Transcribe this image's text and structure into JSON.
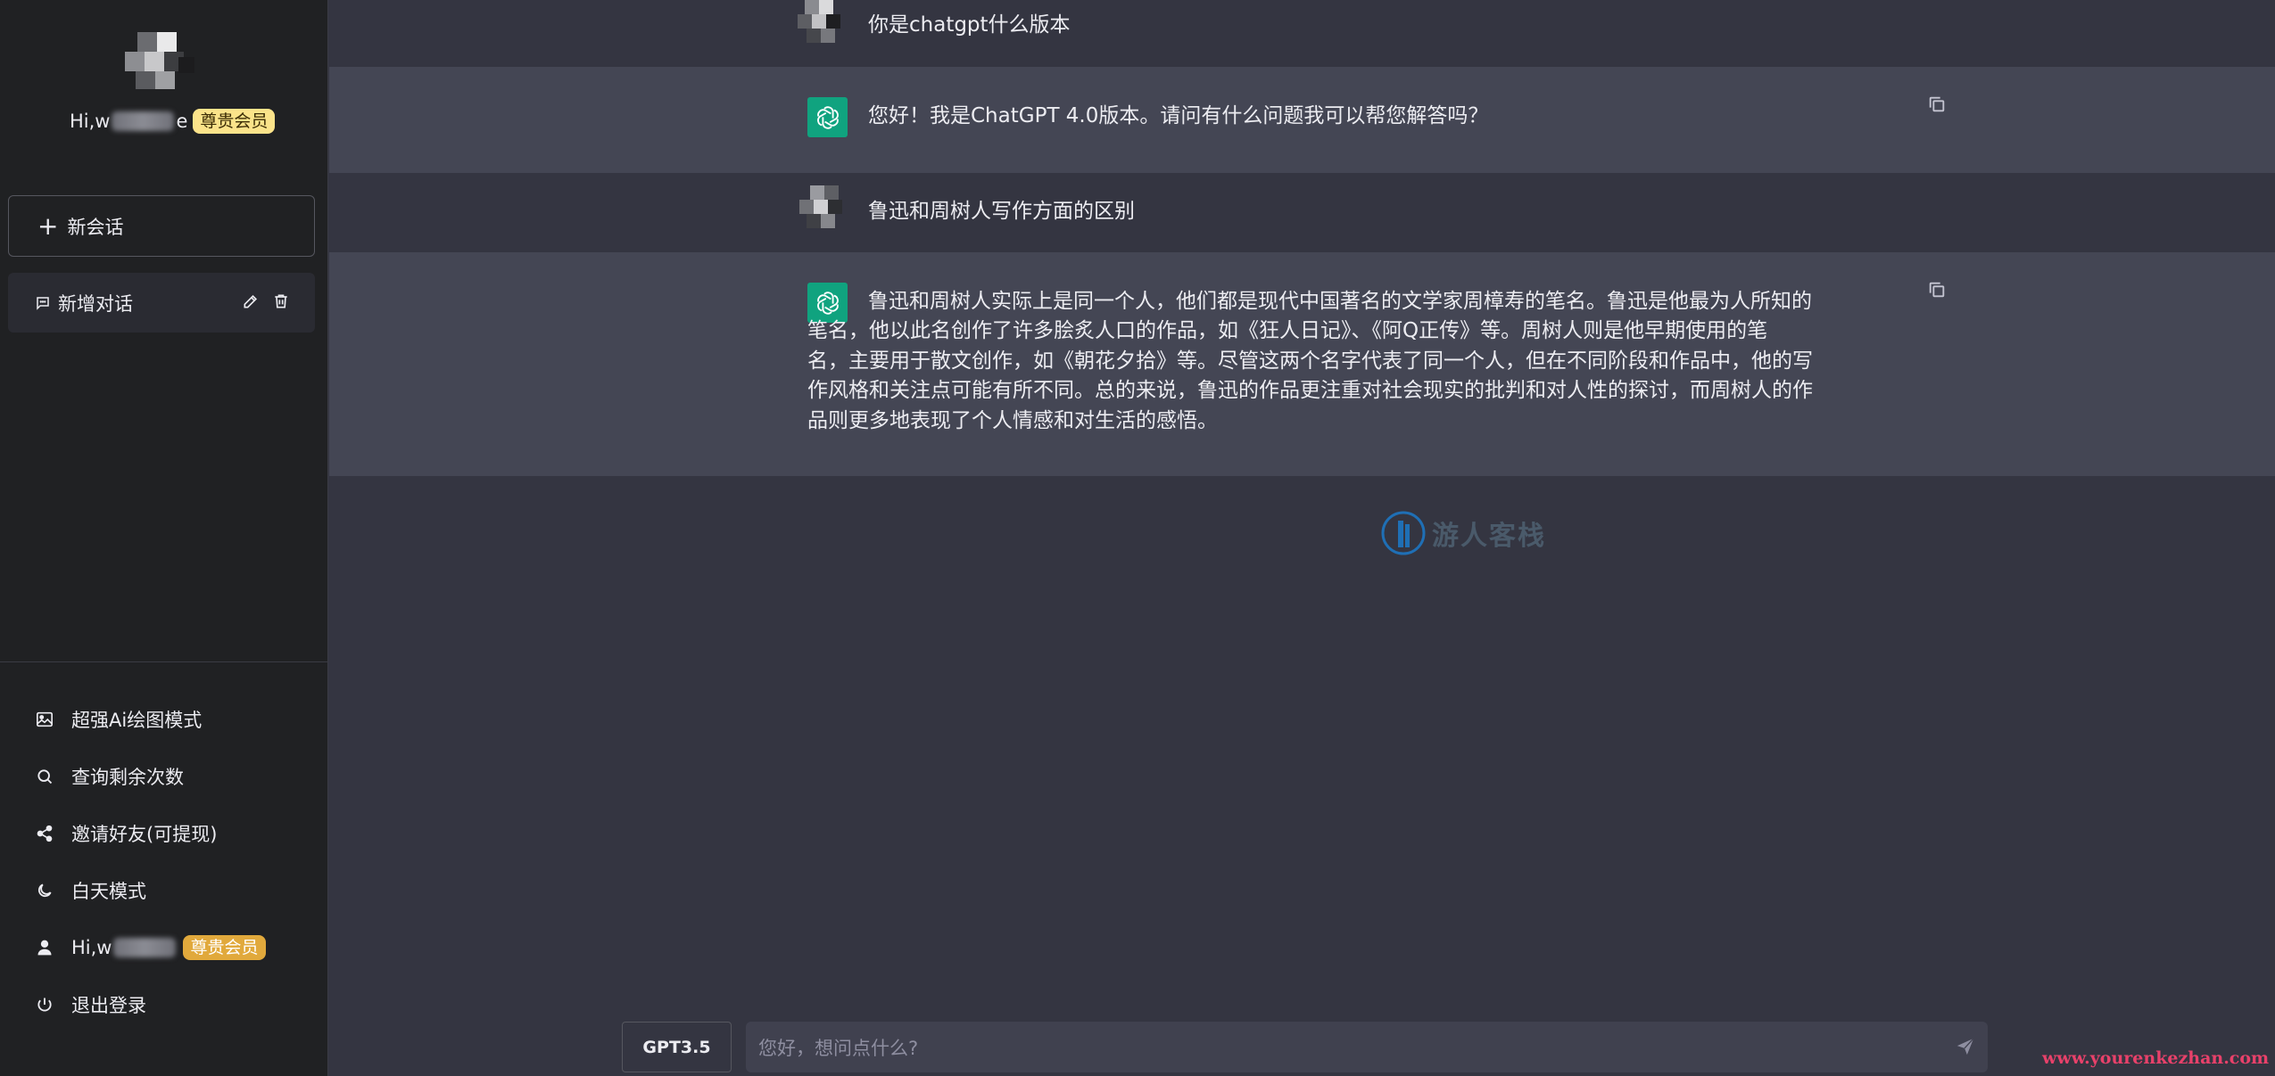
{
  "sidebar": {
    "greeting_prefix": "Hi,w",
    "greeting_suffix": "e",
    "member_badge": "尊贵会员",
    "new_chat_label": "新会话",
    "conversation": {
      "title": "新增对话"
    },
    "menu": [
      {
        "label": "超强Ai绘图模式",
        "icon": "image-icon"
      },
      {
        "label": "查询剩余次数",
        "icon": "search-icon"
      },
      {
        "label": "邀请好友(可提现)",
        "icon": "share-icon"
      },
      {
        "label": "白天模式",
        "icon": "moon-icon"
      },
      {
        "label": "Hi,w",
        "icon": "user-icon",
        "badge": "尊贵会员"
      },
      {
        "label": "退出登录",
        "icon": "power-icon"
      }
    ]
  },
  "messages": [
    {
      "role": "user",
      "text": "你是chatgpt什么版本"
    },
    {
      "role": "assistant",
      "text": "您好！我是ChatGPT 4.0版本。请问有什么问题我可以帮您解答吗？"
    },
    {
      "role": "user",
      "text": "鲁迅和周树人写作方面的区别"
    },
    {
      "role": "assistant",
      "lines": [
        "鲁迅和周树人实际上是同一个人，他们都是现代中国著名的文学家周樟寿的笔名。鲁迅是他最为人所知的",
        "笔名，他以此名创作了许多脍炙人口的作品，如《狂人日记》、《阿Q正传》等。周树人则是他早期使用的笔",
        "名，主要用于散文创作，如《朝花夕拾》等。尽管这两个名字代表了同一个人，但在不同阶段和作品中，他的写",
        "作风格和关注点可能有所不同。总的来说，鲁迅的作品更注重对社会现实的批判和对人性的探讨，而周树人的作",
        "品则更多地表现了个人情感和对生活的感悟。"
      ]
    }
  ],
  "watermark": {
    "title": "游人客栈"
  },
  "input": {
    "model_label": "GPT3.5",
    "placeholder": "您好，想问点什么?"
  },
  "site_watermark": "www.yourenkezhan.com",
  "colors": {
    "sidebar_bg": "#202123",
    "main_bg": "#343541",
    "assistant_row_bg": "#444654",
    "bot_avatar": "#10a37f",
    "badge_yellow": "#fbe38a",
    "badge_gold": "#e1a93c"
  }
}
